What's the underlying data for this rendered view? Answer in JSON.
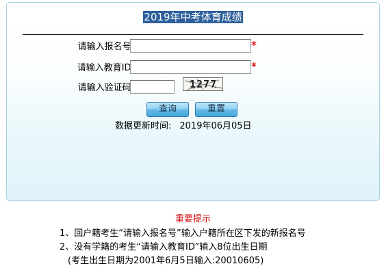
{
  "form": {
    "title": "2019年中考体育成绩",
    "reg_label": "请输入报名号:",
    "reg_value": "",
    "id_label": "请输入教育ID:",
    "id_value": "",
    "captcha_label": "请输入验证码:",
    "captcha_value": "",
    "captcha_image_text": "1277",
    "required_mark": "*",
    "query_button": "查询",
    "reset_button": "重置",
    "update_label": "数据更新时间:",
    "update_value": "2019年06月05日"
  },
  "notes": {
    "title": "重要提示",
    "item1": "1、回户籍考生“请输入报名号”输入户籍所在区下发的新报名号",
    "item2": "2、没有学籍的考生“请输入教育ID”输入8位出生日期",
    "item3": "(考生出生日期为2001年6月5日输入:20010605)"
  },
  "colors": {
    "title_highlight": "#2d5f9b",
    "required": "#e01818",
    "notes_title": "#d01010",
    "button": "#63b9e6"
  }
}
